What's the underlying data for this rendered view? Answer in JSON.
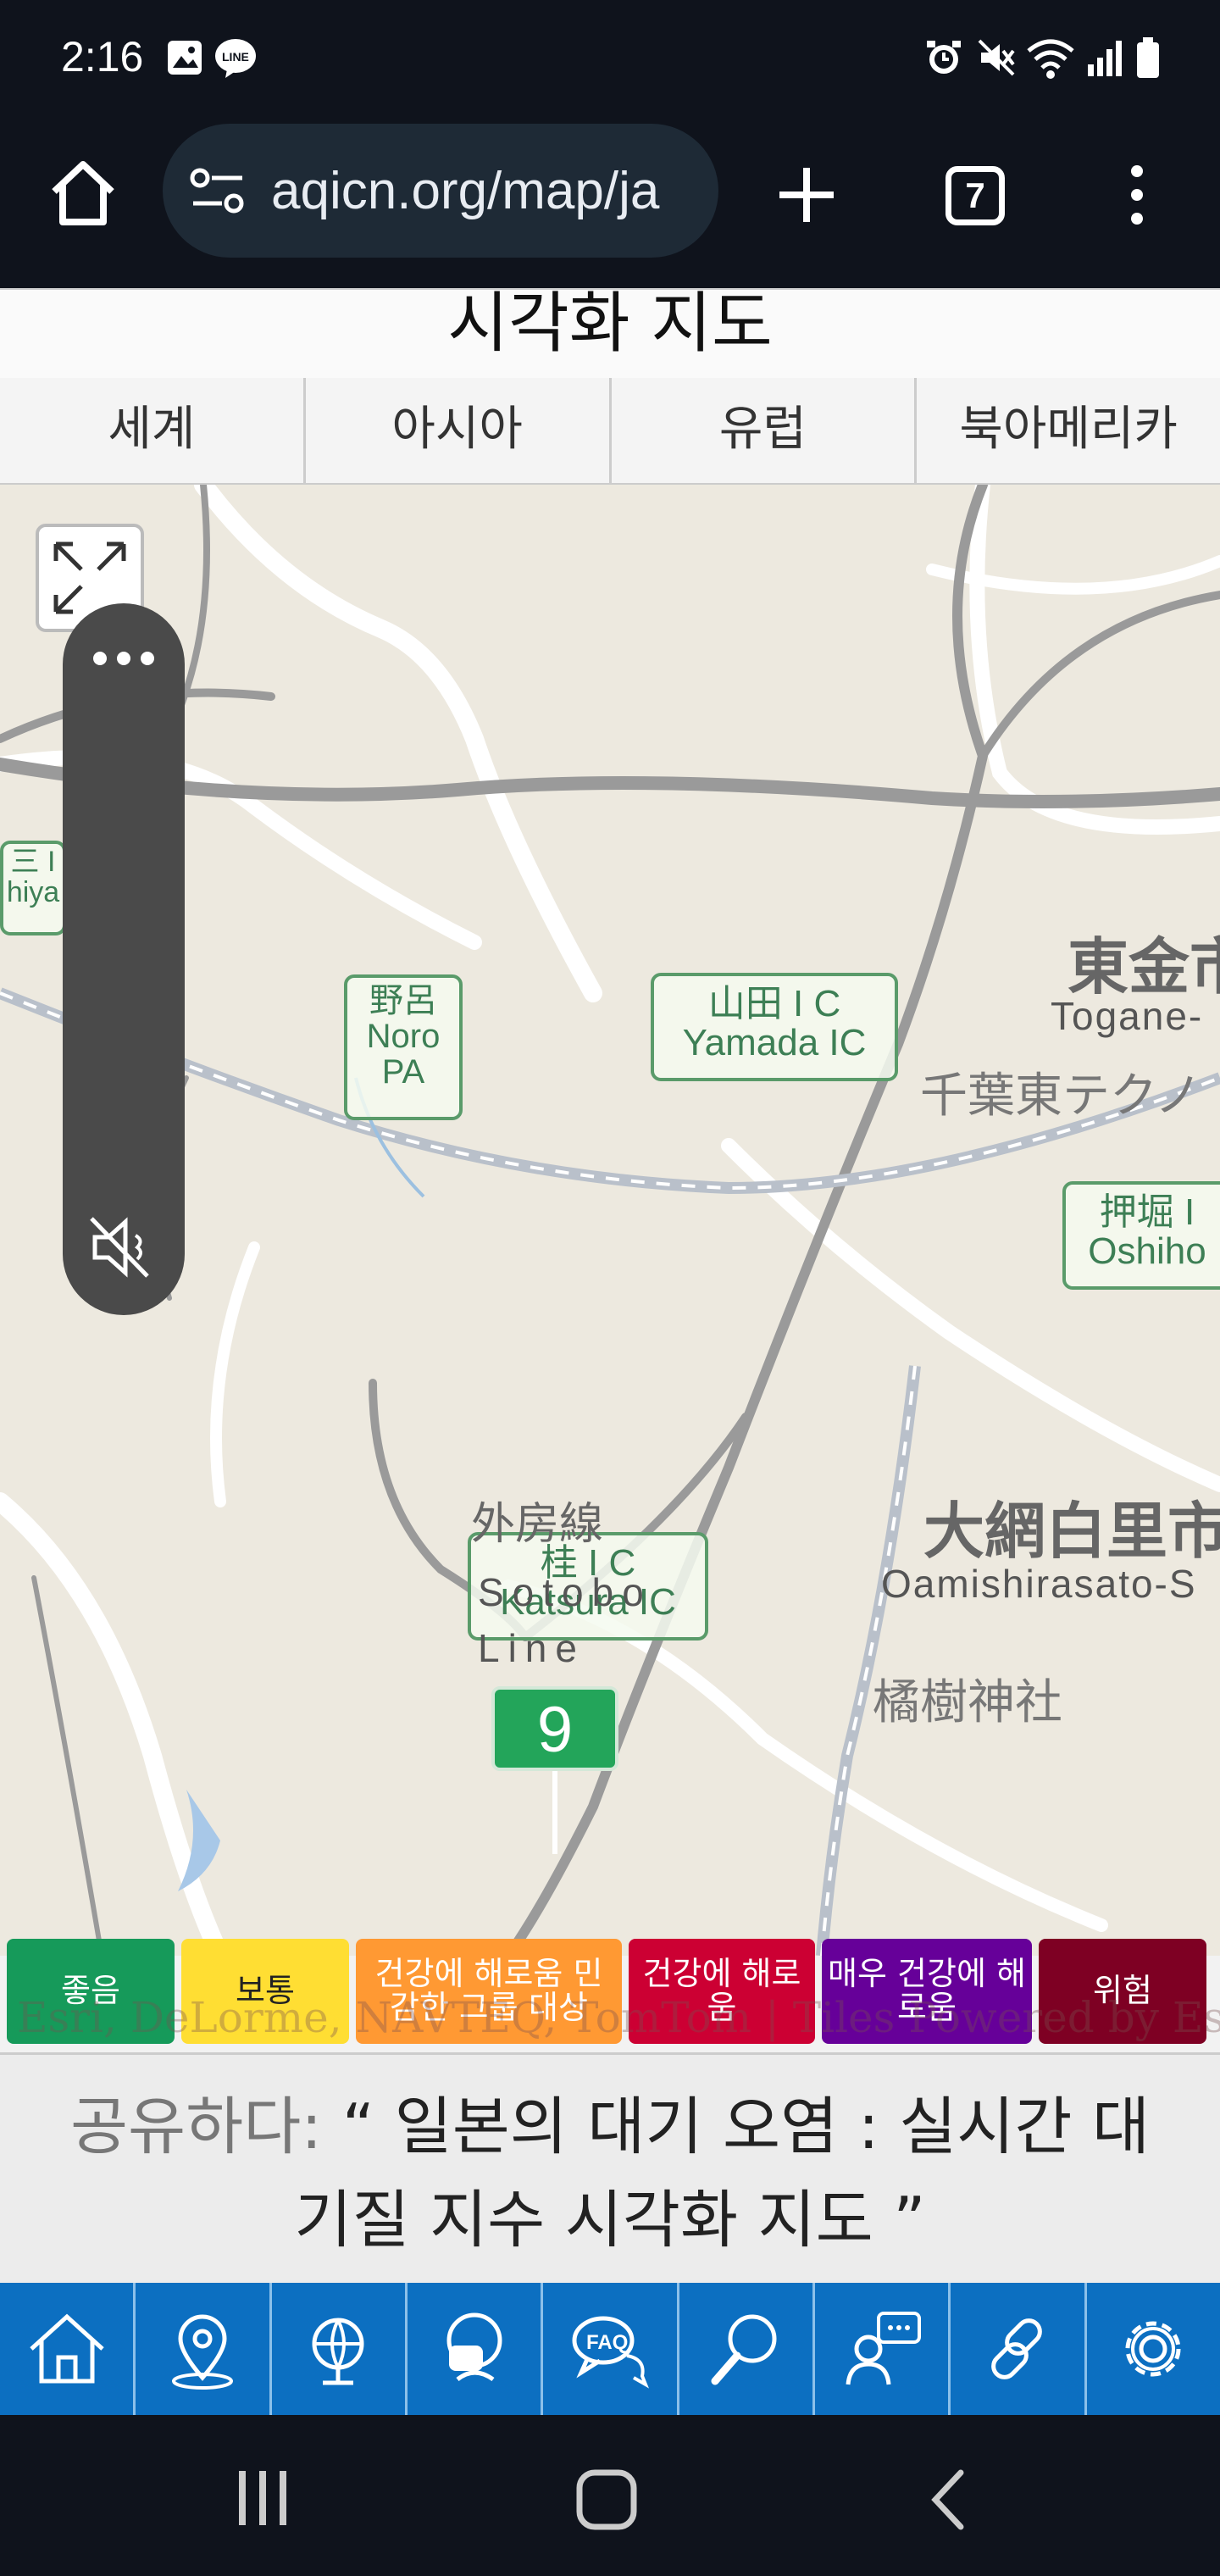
{
  "status_bar": {
    "time": "2:16"
  },
  "browser": {
    "url": "aqicn.org/map/ja",
    "tab_count": "7"
  },
  "page": {
    "title": "시각화 지도",
    "region_tabs": [
      "세계",
      "아시아",
      "유럽",
      "북아메리카"
    ]
  },
  "map": {
    "labels": {
      "noro_pa_jp": "野呂",
      "noro_pa_en1": "Noro",
      "noro_pa_en2": "PA",
      "yamada_ic_jp": "山田 I C",
      "yamada_ic_en": "Yamada IC",
      "katsura_ic_jp": "桂 I C",
      "katsura_ic_en": "Katsura IC",
      "oshiho_jp": "押堀 I",
      "oshiho_en": "Oshiho",
      "togane_jp": "東金市",
      "togane_en": "Togane-",
      "chiba_techno": "千葉東テクノ",
      "oamishirasato_jp": "大網白里市",
      "oamishirasato_en": "Oamishirasato-S",
      "shrine": "橘樹神社",
      "sotobo_jp": "外房線",
      "sotobo_en1": "Sotobo",
      "sotobo_en2": "Line",
      "left_ic_jp": "三 I",
      "left_ic_en": "hiya",
      "attribution": "Esri, DeLorme, NAVTEQ, TomTom | Tiles Powered by Esri"
    },
    "aqi_marker_value": "9"
  },
  "legend": [
    {
      "label": "좋음",
      "color": "#169a5a"
    },
    {
      "label": "보통",
      "color": "#ffde33"
    },
    {
      "label": "건강에 해로움 민감한 그룹 대상",
      "color": "#ff9933"
    },
    {
      "label": "건강에 해로움",
      "color": "#cc0033"
    },
    {
      "label": "매우 건강에 해로움",
      "color": "#660099"
    },
    {
      "label": "위험",
      "color": "#7e0023"
    }
  ],
  "share": {
    "prefix": "공유하다:",
    "text": "“ 일본의 대기 오염 : 실시간 대기질 지수 시각화 지도 ”"
  }
}
